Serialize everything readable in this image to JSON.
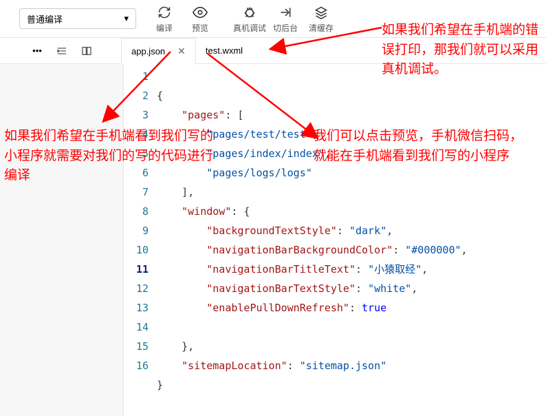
{
  "toolbar": {
    "compile_mode": "普通编译",
    "buttons": [
      {
        "label": "编译"
      },
      {
        "label": "预览"
      },
      {
        "label": "真机调试"
      },
      {
        "label": "切后台"
      },
      {
        "label": "清缓存"
      }
    ]
  },
  "tabs": [
    {
      "name": "app.json",
      "active": true
    },
    {
      "name": "test.wxml",
      "active": false
    }
  ],
  "code": {
    "line2_key": "\"pages\"",
    "line3_str": "\"pages/test/test\"",
    "line4_str": "\"pages/index/index\"",
    "line5_str": "\"pages/logs/logs\"",
    "line7_key": "\"window\"",
    "line8_key": "\"backgroundTextStyle\"",
    "line8_val": "\"dark\"",
    "line9_key": "\"navigationBarBackgroundColor\"",
    "line9_val": "\"#000000\"",
    "line10_key": "\"navigationBarTitleText\"",
    "line10_val": "\"小猿取经\"",
    "line11_key": "\"navigationBarTextStyle\"",
    "line11_val": "\"white\"",
    "line12_key": "\"enablePullDownRefresh\"",
    "line12_val": "true",
    "line15_key": "\"sitemapLocation\"",
    "line15_val": "\"sitemap.json\""
  },
  "annotations": {
    "top_right": "如果我们希望在手机端的错误打印，那我们就可以采用真机调试。",
    "left": "如果我们希望在手机端看到我们写的小程序就需要对我们的写的代码进行编译",
    "mid": "我们可以点击预览，手机微信扫码，就能在手机端看到我们写的小程序"
  }
}
